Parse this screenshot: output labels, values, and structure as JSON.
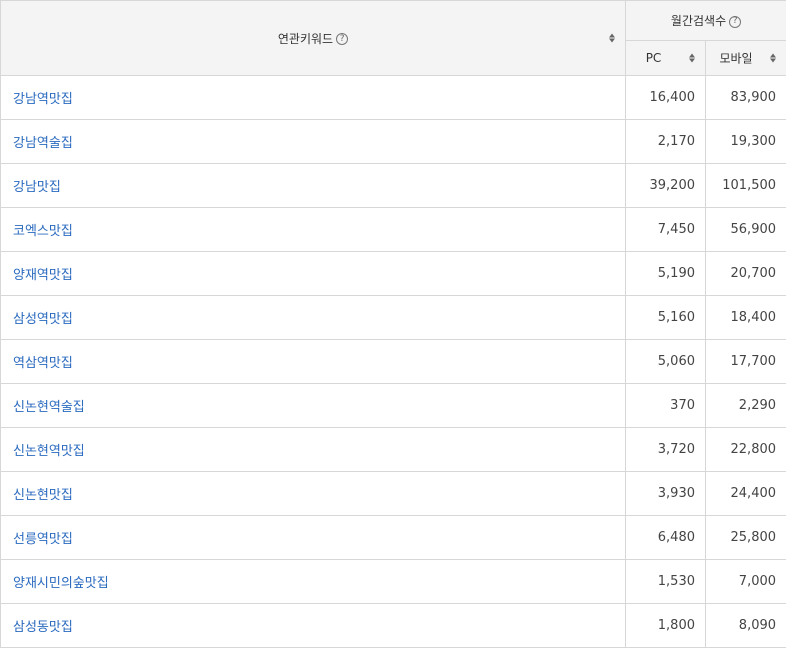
{
  "header": {
    "keyword_label": "연관키워드",
    "monthly_label": "월간검색수",
    "help_glyph": "?",
    "pc_label": "PC",
    "mobile_label": "모바일"
  },
  "rows": [
    {
      "keyword": "강남역맛집",
      "pc": "16,400",
      "mobile": "83,900"
    },
    {
      "keyword": "강남역술집",
      "pc": "2,170",
      "mobile": "19,300"
    },
    {
      "keyword": "강남맛집",
      "pc": "39,200",
      "mobile": "101,500"
    },
    {
      "keyword": "코엑스맛집",
      "pc": "7,450",
      "mobile": "56,900"
    },
    {
      "keyword": "양재역맛집",
      "pc": "5,190",
      "mobile": "20,700"
    },
    {
      "keyword": "삼성역맛집",
      "pc": "5,160",
      "mobile": "18,400"
    },
    {
      "keyword": "역삼역맛집",
      "pc": "5,060",
      "mobile": "17,700"
    },
    {
      "keyword": "신논현역술집",
      "pc": "370",
      "mobile": "2,290"
    },
    {
      "keyword": "신논현역맛집",
      "pc": "3,720",
      "mobile": "22,800"
    },
    {
      "keyword": "신논현맛집",
      "pc": "3,930",
      "mobile": "24,400"
    },
    {
      "keyword": "선릉역맛집",
      "pc": "6,480",
      "mobile": "25,800"
    },
    {
      "keyword": "양재시민의숲맛집",
      "pc": "1,530",
      "mobile": "7,000"
    },
    {
      "keyword": "삼성동맛집",
      "pc": "1,800",
      "mobile": "8,090"
    }
  ]
}
